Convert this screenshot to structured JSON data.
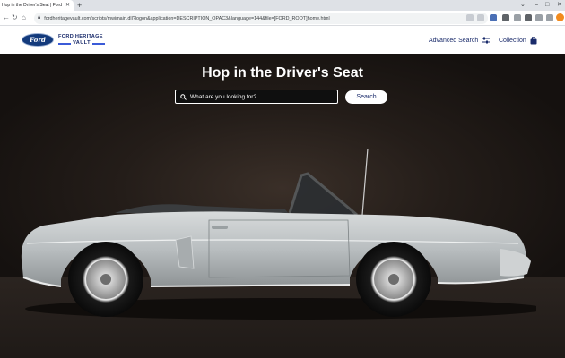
{
  "browser": {
    "tab_title": "Hop in the Driver's Seat | Ford H",
    "tab_close": "✕",
    "new_tab": "+",
    "url": "fordheritagevault.com/scripts/mwimain.dll?logon&application=DESCRIPTION_OPAC3&language=144&file=[FORD_ROOT]home.html",
    "controls": {
      "minimize": "⌄",
      "restore": "–",
      "maximize": "□",
      "close": "✕"
    }
  },
  "header": {
    "brand_logo_text": "Ford",
    "brand_line1": "FORD HERITAGE",
    "brand_line2": "VAULT",
    "nav": {
      "advanced_search": "Advanced Search",
      "collection": "Collection"
    }
  },
  "hero": {
    "title": "Hop in the Driver's Seat",
    "search": {
      "placeholder": "What are you looking for?",
      "button": "Search"
    }
  },
  "colors": {
    "brand_navy": "#1a2b6b",
    "ford_blue": "#133a7c",
    "accent": "#3b5bd8"
  }
}
